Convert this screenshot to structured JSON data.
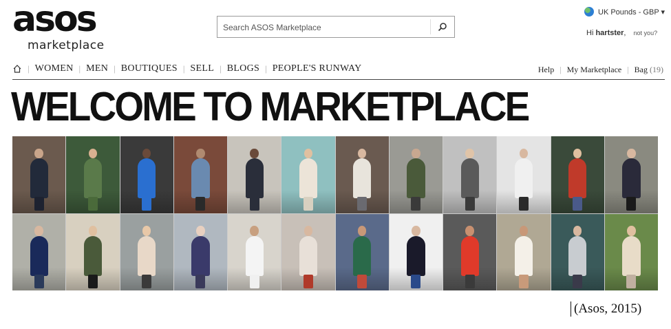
{
  "logo": {
    "word": "asos",
    "sub": "marketplace"
  },
  "search": {
    "placeholder": "Search ASOS Marketplace"
  },
  "account": {
    "currency": "UK Pounds - GBP ▾",
    "greeting_prefix": "Hi",
    "username": "hartster",
    "greeting_suffix": ",",
    "not_you": "not you?"
  },
  "nav": {
    "items": [
      "WOMEN",
      "MEN",
      "BOUTIQUES",
      "SELL",
      "BLOGS",
      "PEOPLE'S RUNWAY"
    ],
    "right": {
      "help": "Help",
      "my_marketplace": "My Marketplace",
      "bag": "Bag",
      "bag_count": "(19)"
    }
  },
  "hero": {
    "title": "WELCOME TO MARKETPLACE"
  },
  "photos": [
    {
      "bg": "#6b5a4e",
      "top": "#222a3a",
      "bottom": "#1d2230",
      "skin": "#c9a58a"
    },
    {
      "bg": "#3d5a3a",
      "top": "#5a7a4a",
      "bottom": "#4a6a3a",
      "skin": "#d8b090"
    },
    {
      "bg": "#3a3a3a",
      "top": "#2a6fd0",
      "bottom": "#2a6fd0",
      "skin": "#6a4a3a"
    },
    {
      "bg": "#7a4a3a",
      "top": "#6a8ab0",
      "bottom": "#2a2a2a",
      "skin": "#b08a70"
    },
    {
      "bg": "#c8c4bc",
      "top": "#2a2e3a",
      "bottom": "#2a2e3a",
      "skin": "#6a4a3a"
    },
    {
      "bg": "#8fc0c0",
      "top": "#ece4d8",
      "bottom": "#d8d0c0",
      "skin": "#e0c0a0"
    },
    {
      "bg": "#6a5a50",
      "top": "#e8e4dc",
      "bottom": "#6a6a70",
      "skin": "#d8b8a0"
    },
    {
      "bg": "#9a9a94",
      "top": "#4a5a3a",
      "bottom": "#3a3a3a",
      "skin": "#c8a890"
    },
    {
      "bg": "#c0c0c0",
      "top": "#5a5a5a",
      "bottom": "#3a3a3a",
      "skin": "#e0c4a8"
    },
    {
      "bg": "#e4e4e4",
      "top": "#f0f0f0",
      "bottom": "#2a2a2a",
      "skin": "#d8b8a0"
    },
    {
      "bg": "#3a4a3a",
      "top": "#c03a2a",
      "bottom": "#4a5a8a",
      "skin": "#e0c0a0"
    },
    {
      "bg": "#8a8a80",
      "top": "#2a2a3a",
      "bottom": "#1a1a1a",
      "skin": "#d8b8a0"
    },
    {
      "bg": "#b0b0a8",
      "top": "#1a2a5a",
      "bottom": "#2a3a5a",
      "skin": "#d8b8a0"
    },
    {
      "bg": "#d8d0c0",
      "top": "#4a5a3a",
      "bottom": "#1a1a1a",
      "skin": "#e0c0a0"
    },
    {
      "bg": "#9aa0a0",
      "top": "#e8d8c8",
      "bottom": "#3a3a3a",
      "skin": "#e8c8a8"
    },
    {
      "bg": "#b0b8c0",
      "top": "#3a3a6a",
      "bottom": "#3a3a5a",
      "skin": "#e8d0c0"
    },
    {
      "bg": "#d8d4cc",
      "top": "#f4f4f4",
      "bottom": "#f0f0f0",
      "skin": "#c8a080"
    },
    {
      "bg": "#c8c0b8",
      "top": "#e8e0d8",
      "bottom": "#b03a2a",
      "skin": "#d8b8a0"
    },
    {
      "bg": "#5a6a8a",
      "top": "#2a6a4a",
      "bottom": "#c04a3a",
      "skin": "#c89878"
    },
    {
      "bg": "#f0f0f0",
      "top": "#1a1a2a",
      "bottom": "#2a4a8a",
      "skin": "#d8b8a0"
    },
    {
      "bg": "#5a5a5a",
      "top": "#e03a2a",
      "bottom": "#3a3a3a",
      "skin": "#c89070"
    },
    {
      "bg": "#b0a894",
      "top": "#f4f0e8",
      "bottom": "#c89a7a",
      "skin": "#c89878"
    },
    {
      "bg": "#3a5a5a",
      "top": "#c8ccd0",
      "bottom": "#3a3a4a",
      "skin": "#d8b8a0"
    },
    {
      "bg": "#6a8a4a",
      "top": "#e8dcc8",
      "bottom": "#c0b0a0",
      "skin": "#e0c0a0"
    }
  ],
  "caption": "(Asos, 2015)"
}
